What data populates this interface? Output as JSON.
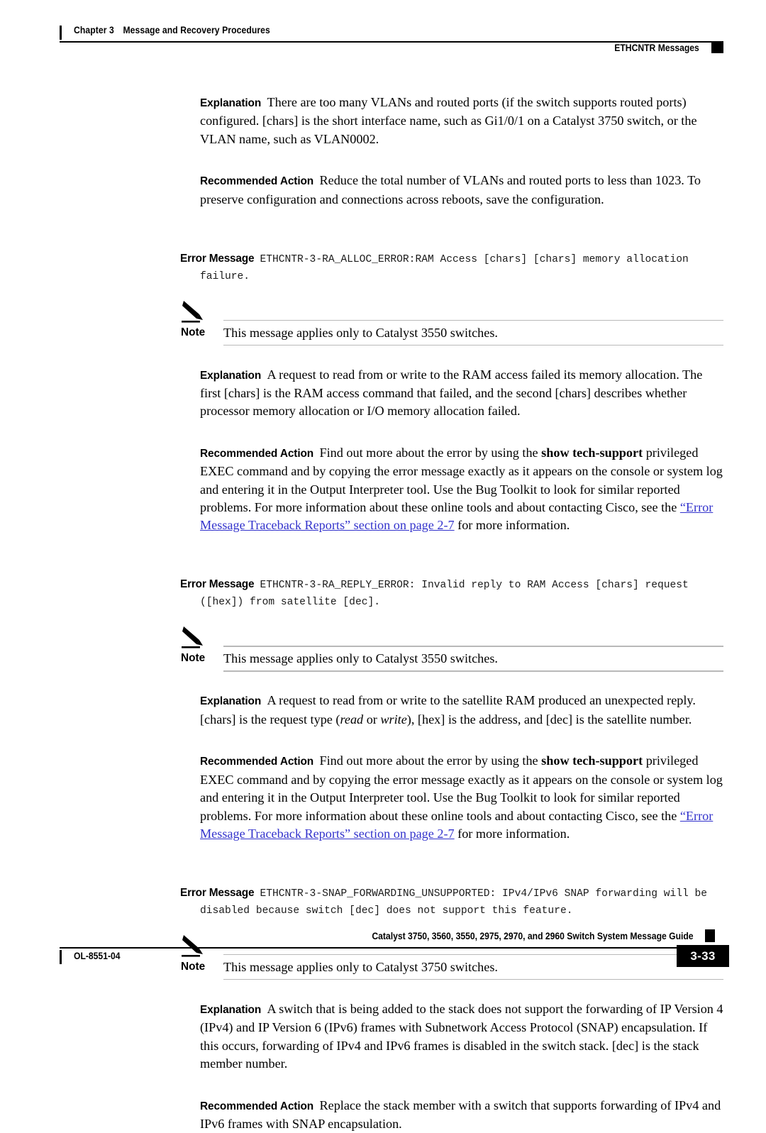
{
  "header": {
    "chapter": "Chapter 3",
    "chapter_title": "Message and Recovery Procedures",
    "section": "ETHCNTR Messages"
  },
  "footer": {
    "guide_title": "Catalyst 3750, 3560, 3550, 2975, 2970, and 2960 Switch System Message Guide",
    "doc_id": "OL-8551-04",
    "page_number": "3-33"
  },
  "labels": {
    "explanation": "Explanation",
    "recommended_action": "Recommended Action",
    "error_message": "Error Message",
    "note": "Note"
  },
  "colors": {
    "link": "#3333cc",
    "rule": "#b9b9b9",
    "text": "#000000",
    "mono_text": "#1a1a1a"
  },
  "blocks": {
    "explanation_0": {
      "text_a": "There are too many VLANs and routed ports (if the switch supports routed ports) configured. [chars] is the short interface name, such as Gi1/0/1 on a Catalyst 3750 switch, or the VLAN name, such as VLAN0002."
    },
    "action_0": {
      "text_a": "Reduce the total number of VLANs and routed ports to less than 1023. To preserve configuration and connections across reboots, save the configuration."
    },
    "errmsg_1": {
      "text": "ETHCNTR-3-RA_ALLOC_ERROR:RAM Access [chars] [chars] memory allocation failure."
    },
    "note_1": {
      "text": "This message applies only to Catalyst 3550 switches."
    },
    "explanation_1": {
      "text_a": "A request to read from or write to the RAM access failed its memory allocation. The first [chars] is the RAM access command that failed, and the second [chars] describes whether processor memory allocation or I/O memory allocation failed."
    },
    "action_1": {
      "part_1": "Find out more about the error by using the ",
      "cmd": "show tech-support",
      "part_2": " privileged EXEC command and by copying the error message exactly as it appears on the console or system log and entering it in the Output Interpreter tool. Use the Bug Toolkit to look for similar reported problems. For more information about these online tools and about contacting Cisco, see the ",
      "link": "“Error Message Traceback Reports” section on page 2-7",
      "part_3": " for more information."
    },
    "errmsg_2": {
      "text": "ETHCNTR-3-RA_REPLY_ERROR: Invalid reply to RAM Access [chars] request ([hex]) from satellite [dec]."
    },
    "note_2": {
      "text": "This message applies only to Catalyst 3550 switches."
    },
    "explanation_2": {
      "part_1": "A request to read from or write to the satellite RAM produced an unexpected reply. [chars] is the request type (",
      "italic_1": "read",
      "part_2": " or ",
      "italic_2": "write",
      "part_3": "), [hex] is the address, and [dec] is the satellite number."
    },
    "action_2": {
      "part_1": "Find out more about the error by using the ",
      "cmd": "show tech-support",
      "part_2": " privileged EXEC command and by copying the error message exactly as it appears on the console or system log and entering it in the Output Interpreter tool. Use the Bug Toolkit to look for similar reported problems. For more information about these online tools and about contacting Cisco, see the ",
      "link": "“Error Message Traceback Reports” section on page 2-7",
      "part_3": " for more information."
    },
    "errmsg_3": {
      "text": "ETHCNTR-3-SNAP_FORWARDING_UNSUPPORTED: IPv4/IPv6 SNAP forwarding will be disabled because switch [dec] does not support this feature."
    },
    "note_3": {
      "text": "This message applies only to Catalyst 3750 switches."
    },
    "explanation_3": {
      "text_a": "A switch that is being added to the stack does not support the forwarding of IP Version 4 (IPv4) and IP Version 6 (IPv6) frames with Subnetwork Access Protocol (SNAP) encapsulation. If this occurs, forwarding of IPv4 and IPv6 frames is disabled in the switch stack. [dec] is the stack member number."
    },
    "action_3": {
      "text_a": "Replace the stack member with a switch that supports forwarding of IPv4 and IPv6 frames with SNAP encapsulation."
    }
  }
}
